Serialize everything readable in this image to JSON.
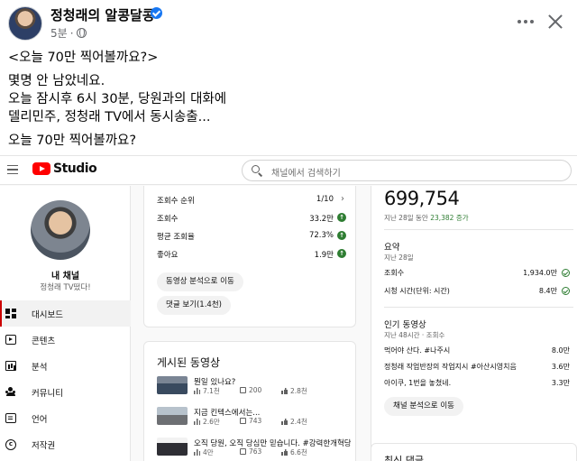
{
  "post": {
    "author": "정청래의 알콩달콩",
    "time": "5분",
    "dot": "·",
    "lines": [
      "<오늘 70만 찍어볼까요?>",
      "몇명 안 남았네요.",
      "오늘 잠시후 6시 30분, 당원과의 대화에",
      "델리민주, 정청래 TV에서 동시송출...",
      "오늘 70만 찍어볼까요?"
    ]
  },
  "studio": {
    "brand": "Studio",
    "search_placeholder": "채널에서 검색하기",
    "channel": {
      "title": "내 채널",
      "name": "정청래 TV떴다!"
    },
    "nav": [
      "대시보드",
      "콘텐츠",
      "분석",
      "커뮤니티",
      "언어",
      "저작권"
    ],
    "analytics_card": {
      "rank_label": "조회수 순위",
      "rank_value": "1/10",
      "rows": [
        {
          "label": "조회수",
          "value": "33.2만"
        },
        {
          "label": "평균 조회율",
          "value": "72.3%"
        },
        {
          "label": "좋아요",
          "value": "1.9만"
        }
      ],
      "up_symbol": "↑",
      "chevron": "›",
      "btn_video_analytics": "동영상 분석으로 이동",
      "btn_comments": "댓글 보기(1.4천)"
    },
    "published": {
      "heading": "게시된 동영상",
      "videos": [
        {
          "title": "뭔일 있나요?",
          "views": "7.1천",
          "comments": "200",
          "likes": "2.8천"
        },
        {
          "title": "지금 킨텍스에서는...",
          "views": "2.6만",
          "comments": "743",
          "likes": "2.4천"
        },
        {
          "title": "오직 당원, 오직 당심만 믿습니다. #강력한개혁당대...",
          "views": "4만",
          "comments": "763",
          "likes": "6.6천"
        }
      ]
    },
    "subscribers": {
      "count": "699,754",
      "period_text": "지난 28일 동안",
      "delta": "23,382 증가",
      "summary_title": "요약",
      "summary_sub": "지난 28일",
      "summary_rows": [
        {
          "label": "조회수",
          "value": "1,934.0만"
        },
        {
          "label": "시청 시간(단위: 시간)",
          "value": "8.4만"
        }
      ],
      "popular_title": "인기 동영상",
      "popular_sub": "지난 48시간 · 조회수",
      "popular_rows": [
        {
          "label": "먹어야 산다. #나주시",
          "value": "8.0만"
        },
        {
          "label": "정청래 작업반장의 작업지시 #아산시영치음",
          "value": "3.6만"
        },
        {
          "label": "아이쿠, 1번을 놓쳤네.",
          "value": "3.3만"
        }
      ],
      "btn_channel_analytics": "채널 분석으로 이동",
      "next_card_peek": "최신 댓글"
    }
  },
  "colors": {
    "verified": "#1877f2",
    "yt_red": "#ff0000",
    "positive": "#2e7d32"
  },
  "icons": [
    "verified-badge-icon",
    "globe-icon",
    "more-icon",
    "close-icon",
    "hamburger-icon",
    "youtube-logo-icon",
    "search-icon"
  ]
}
